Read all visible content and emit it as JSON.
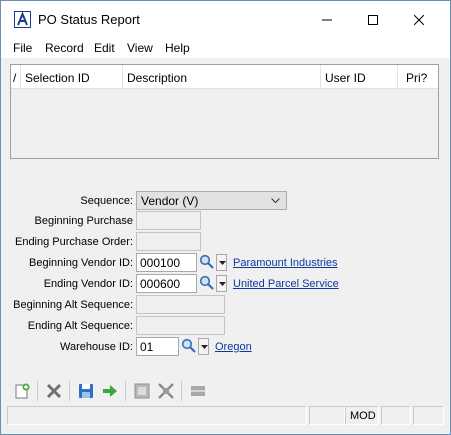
{
  "window": {
    "title": "PO Status Report"
  },
  "menu": [
    "File",
    "Record",
    "Edit",
    "View",
    "Help"
  ],
  "grid": {
    "columns": [
      "/",
      "Selection ID",
      "Description",
      "User ID",
      "Pri?"
    ]
  },
  "form": {
    "sequence": {
      "label": "Sequence:",
      "value": "Vendor (V)"
    },
    "begin_po": {
      "label": "Beginning Purchase",
      "value": ""
    },
    "end_po": {
      "label": "Ending Purchase Order:",
      "value": ""
    },
    "begin_vendor": {
      "label": "Beginning Vendor ID:",
      "value": "000100",
      "link": "Paramount Industries"
    },
    "end_vendor": {
      "label": "Ending Vendor ID:",
      "value": "000600",
      "link": "United Parcel Service"
    },
    "begin_alt": {
      "label": "Beginning Alt Sequence:",
      "value": ""
    },
    "end_alt": {
      "label": "Ending Alt Sequence:",
      "value": ""
    },
    "warehouse": {
      "label": "Warehouse ID:",
      "value": "01",
      "link": "Oregon"
    }
  },
  "toolbar": [
    "new-icon",
    "delete-icon",
    "save-icon",
    "go-arrow-icon",
    "print-icon",
    "expand-icon",
    "collapse-icon"
  ],
  "status": {
    "mode": "MOD"
  },
  "colors": {
    "link": "#0b3a9e",
    "title_bg": "#ffffff",
    "window_bg": "#f0f0f0"
  }
}
